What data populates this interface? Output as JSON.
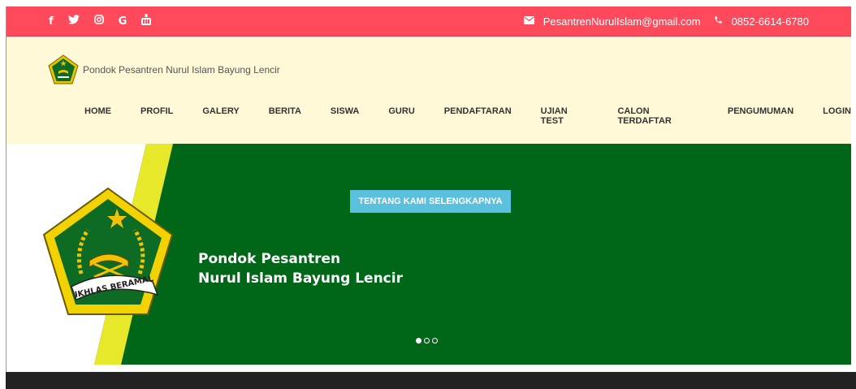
{
  "topbar": {
    "social": [
      {
        "icon": "facebook-icon",
        "glyph": "f"
      },
      {
        "icon": "twitter-icon",
        "glyph": "🐦"
      },
      {
        "icon": "instagram-icon",
        "glyph": "◎"
      },
      {
        "icon": "google-icon",
        "glyph": "G"
      },
      {
        "icon": "youtube-icon",
        "glyph": "▶"
      }
    ],
    "email": "PesantrenNurulIslam@gmail.com",
    "phone": "0852-6614-6780",
    "background_color": "#ff4a5c"
  },
  "header": {
    "brand_text": "Pondok Pesantren Nurul Islam Bayung Lencir",
    "background_color": "#fff9d8"
  },
  "nav": {
    "items": [
      "HOME",
      "PROFIL",
      "GALERY",
      "BERITA",
      "SISWA",
      "GURU",
      "PENDAFTARAN",
      "UJIAN TEST",
      "CALON TERDAFTAR",
      "PENGUMUMAN",
      "LOGIN"
    ]
  },
  "hero": {
    "button_label": "TENTANG KAMI SELENGKAPNYA",
    "title_line1": "Pondok Pesantren",
    "title_line2": "Nurul Islam Bayung Lencir",
    "emblem_ribbon_text": "IKHLAS BERAMAL",
    "green_color": "#006618",
    "yellow_color": "#e8e82a",
    "button_color": "#5bc0de",
    "slides": 3,
    "active_slide": 1
  }
}
